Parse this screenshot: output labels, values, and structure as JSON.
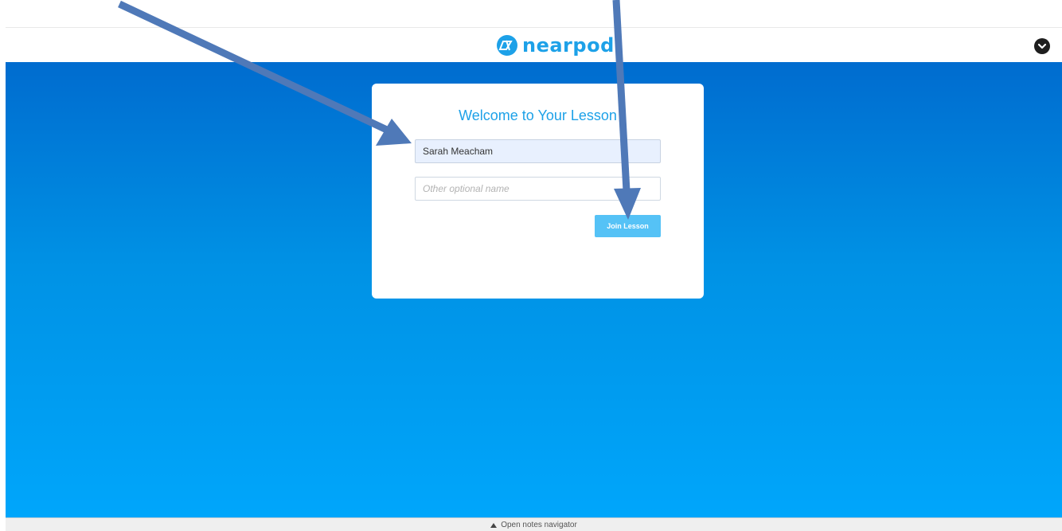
{
  "header": {
    "logo_text": "nearpod",
    "menu_icon": "chevron-down-circle-icon",
    "brand_color": "#1da1e8"
  },
  "card": {
    "title": "Welcome to Your Lesson",
    "name_field": {
      "value": "Sarah Meacham"
    },
    "other_name_field": {
      "placeholder": "Other optional name"
    },
    "join_button_label": "Join Lesson"
  },
  "footer": {
    "label": "Open notes navigator",
    "icon": "triangle-up-icon"
  },
  "annotations": {
    "arrow_color": "#4f79b8",
    "arrows": [
      "pointing to name field",
      "pointing to join lesson button"
    ]
  },
  "colors": {
    "gradient_top": "#006ccf",
    "gradient_bottom": "#00a6fb",
    "join_button": "#55c2f6"
  }
}
